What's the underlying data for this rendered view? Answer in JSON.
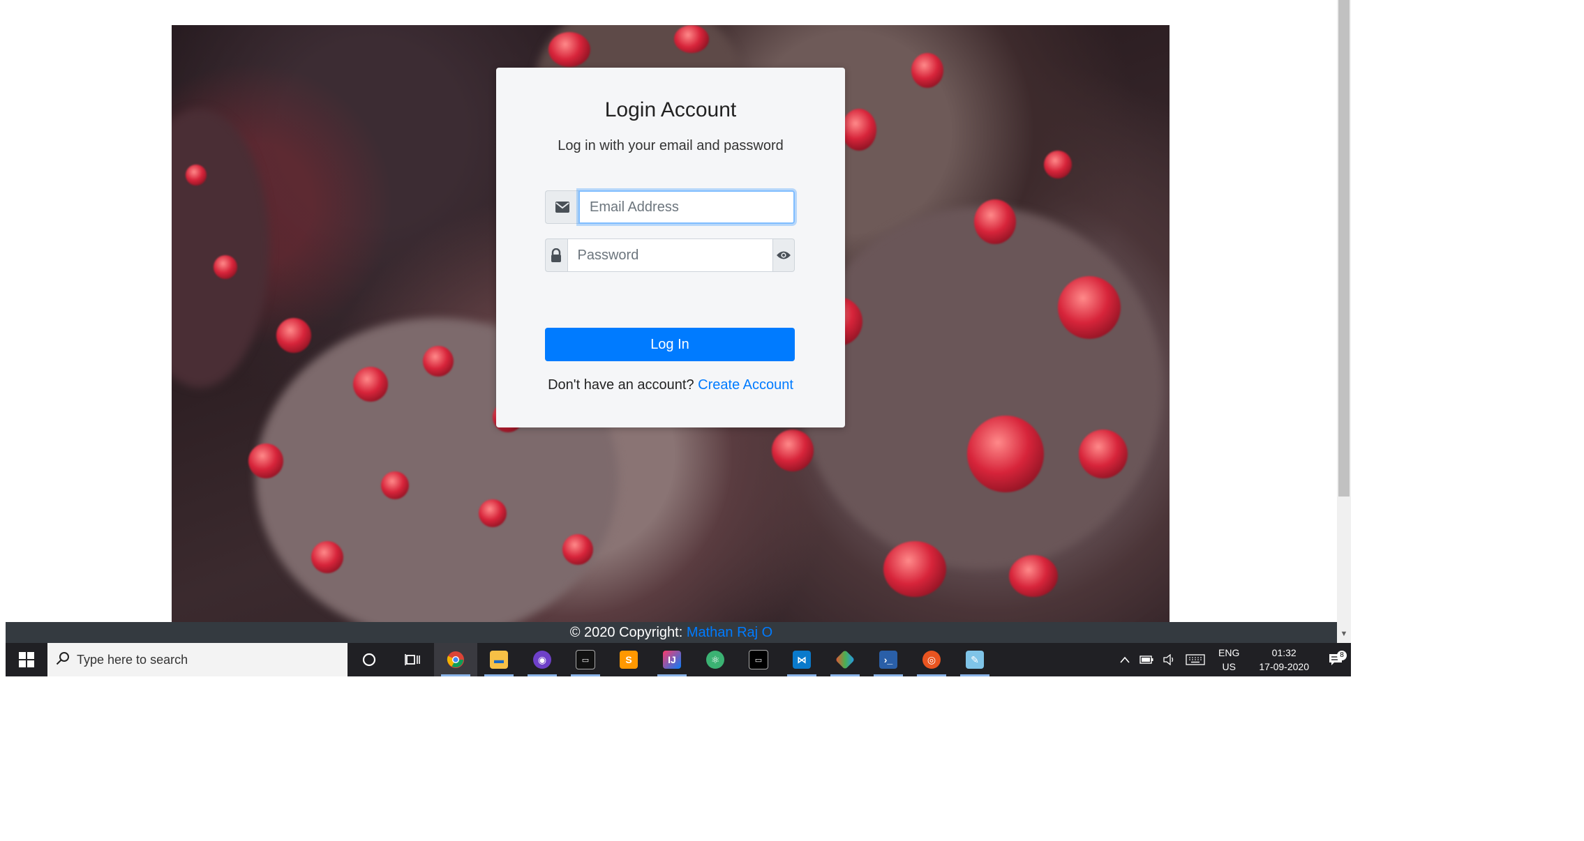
{
  "card": {
    "title": "Login Account",
    "subtitle": "Log in with your email and password",
    "email_placeholder": "Email Address",
    "password_placeholder": "Password",
    "login_label": "Log In",
    "signup_prompt": "Don't have an account?",
    "signup_link": "Create Account"
  },
  "footer": {
    "copyright": "© 2020 Copyright:",
    "author": "Mathan Raj O"
  },
  "taskbar": {
    "search_placeholder": "Type here to search",
    "apps": [
      "chrome-icon",
      "file-explorer-icon",
      "github-desktop-icon",
      "terminal-icon",
      "sublime-text-icon",
      "intellij-icon",
      "atom-icon",
      "command-prompt-icon",
      "vscode-icon",
      "git-icon",
      "powershell-icon",
      "ubuntu-icon",
      "notepad-icon"
    ],
    "language": "ENG",
    "region": "US",
    "time": "01:32",
    "date": "17-09-2020",
    "notification_count": "8"
  },
  "colors": {
    "primary": "#007bff",
    "footer_bg": "#343a40",
    "card_bg": "#f5f6f8"
  }
}
